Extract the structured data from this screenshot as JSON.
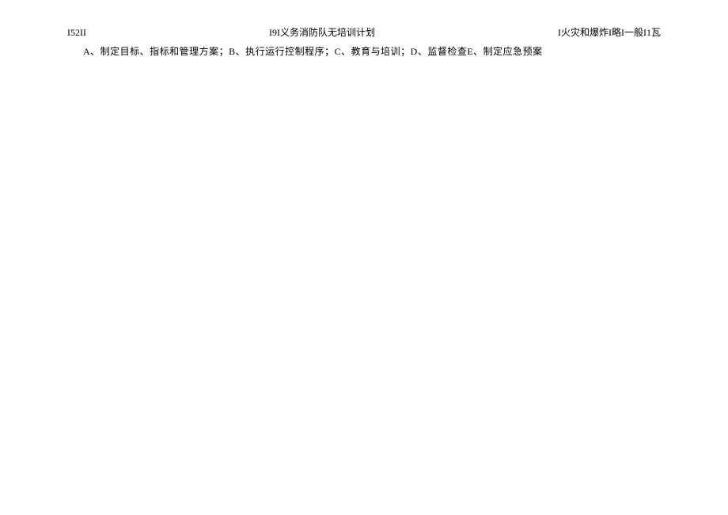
{
  "header": {
    "left": "I52II",
    "center": "I9I义务消防队无培训计划",
    "right": "I火灾和爆炸I略I一般I1瓦"
  },
  "body": {
    "line1": "A、制定目标、指标和管理方案；B、执行运行控制程序；C、教育与培训；D、监督检查E、制定应急预案"
  }
}
